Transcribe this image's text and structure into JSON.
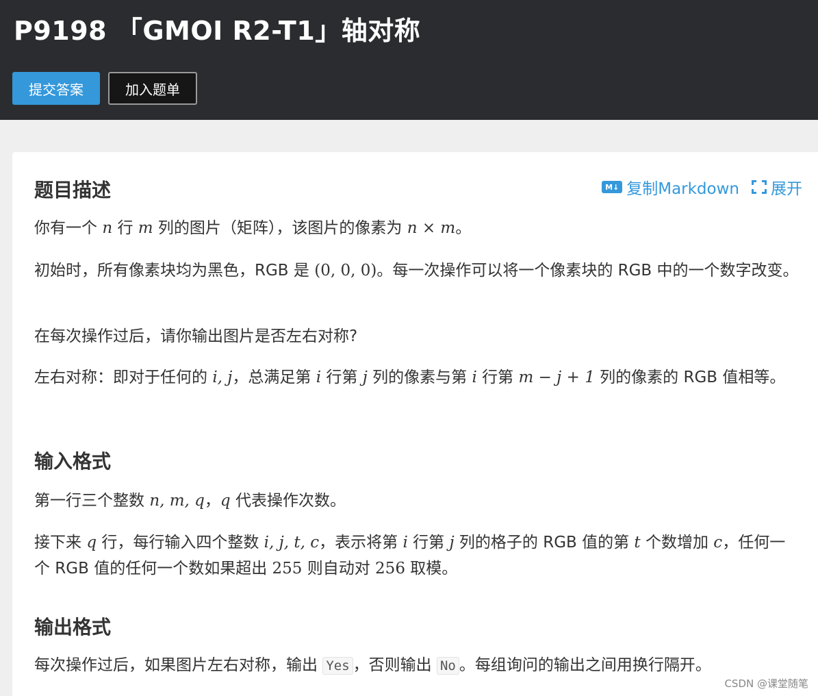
{
  "header": {
    "title": "P9198 「GMOI R2-T1」轴对称",
    "submit_label": "提交答案",
    "add_list_label": "加入题单"
  },
  "tools": {
    "markdown_icon": "M↓",
    "copy_markdown_label": "复制Markdown",
    "expand_label": "展开"
  },
  "sections": {
    "description_title": "题目描述",
    "input_title": "输入格式",
    "output_title": "输出格式"
  },
  "description": {
    "p1_a": "你有一个 ",
    "p1_n": "n",
    "p1_b": " 行 ",
    "p1_m": "m",
    "p1_c": " 列的图片（矩阵），该图片的像素为 ",
    "p1_nm": "n × m",
    "p1_d": "。",
    "p2_a": "初始时，所有像素块均为黑色，RGB 是 ",
    "p2_rgb": "(0, 0, 0)",
    "p2_b": "。每一次操作可以将一个像素块的 RGB 中的一个数字改变。",
    "p3": "在每次操作过后，请你输出图片是否左右对称?",
    "p4_a": "左右对称：即对于任何的 ",
    "p4_ij": "i, j",
    "p4_b": "，总满足第 ",
    "p4_i": "i",
    "p4_c": " 行第 ",
    "p4_j": "j",
    "p4_d": " 列的像素与第 ",
    "p4_i2": "i",
    "p4_e": " 行第 ",
    "p4_expr": "m − j + 1",
    "p4_f": " 列的像素的 RGB 值相等。"
  },
  "input": {
    "p1_a": "第一行三个整数 ",
    "p1_nmq": "n, m, q",
    "p1_b": "，",
    "p1_q": "q",
    "p1_c": " 代表操作次数。",
    "p2_a": "接下来 ",
    "p2_q": "q",
    "p2_b": " 行，每行输入四个整数 ",
    "p2_ijtc": "i, j, t, c",
    "p2_c": "，表示将第 ",
    "p2_i": "i",
    "p2_d": " 行第 ",
    "p2_j": "j",
    "p2_e": " 列的格子的 RGB 值的第 ",
    "p2_t": "t",
    "p2_f": " 个数增加 ",
    "p2_cc": "c",
    "p2_g": "，任何一个 RGB 值的任何一个数如果超出 ",
    "p2_255": "255",
    "p2_h": " 则自动对 ",
    "p2_256": "256",
    "p2_k": " 取模。"
  },
  "output": {
    "p1_a": "每次操作过后，如果图片左右对称，输出 ",
    "p1_yes": "Yes",
    "p1_b": "，否则输出 ",
    "p1_no": "No",
    "p1_c": "。每组询问的输出之间用换行隔开。"
  },
  "watermark": "CSDN @课堂随笔"
}
